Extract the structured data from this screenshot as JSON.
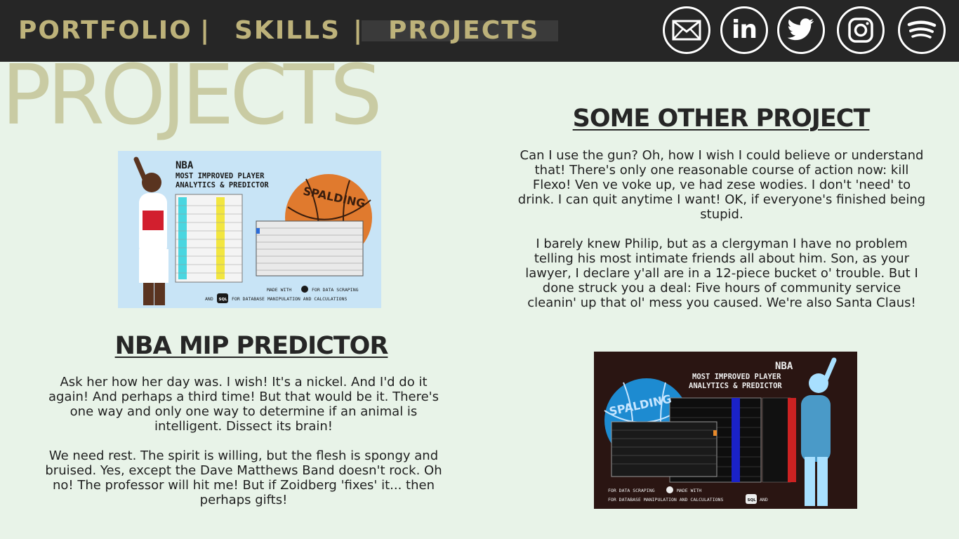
{
  "nav": {
    "portfolio": "PORTFOLIO",
    "separator": "|",
    "skills": "SKILLS",
    "projects": "PROJECTS"
  },
  "social": {
    "icons": [
      "mail-icon",
      "linkedin-icon",
      "twitter-icon",
      "instagram-icon",
      "spotify-icon"
    ],
    "linkedin_text": "in"
  },
  "colors": {
    "nav_bg": "#262626",
    "nav_text": "#bdb27a",
    "page_bg": "#e8f3e8",
    "heading_faded": "#c9cba3"
  },
  "page_title": "PROJECTS",
  "projects": [
    {
      "title": "NBA MIP PREDICTOR",
      "paragraphs": [
        "Ask her how her day was. I wish! It's a nickel. And I'd do it again! And perhaps a third time! But that would be it. There's one way and only one way to determine if an animal is intelligent. Dissect its brain!",
        "We need rest. The spirit is willing, but the flesh is spongy and bruised. Yes, except the Dave Matthews Band doesn't rock. Oh no! The professor will hit me! But if Zoidberg 'fixes' it... then perhaps gifts!"
      ],
      "image": {
        "heading": "NBA",
        "line1": "MOST IMPROVED PLAYER",
        "line2": "ANALYTICS & PREDICTOR",
        "ball_brand": "SPALDING",
        "footer1": "MADE WITH",
        "footer1b": "FOR DATA SCRAPING",
        "footer2": "AND",
        "footer2b": "FOR DATABASE MANIPULATION AND CALCULATIONS",
        "sql_badge": "SQL"
      }
    },
    {
      "title": "SOME OTHER PROJECT",
      "paragraphs": [
        "Can I use the gun? Oh, how I wish I could believe or understand that! There's only one reasonable course of action now: kill Flexo! Ven ve voke up, ve had zese wodies. I don't 'need' to drink. I can quit anytime I want! OK, if everyone's finished being stupid.",
        "I barely knew Philip, but as a clergyman I have no problem telling his most intimate friends all about him. Son, as your lawyer, I declare y'all are in a 12-piece bucket o' trouble. But I done struck you a deal: Five hours of community service cleanin' up that ol' mess you caused. We're also Santa Claus!"
      ],
      "image": {
        "heading": "NBA",
        "line1": "MOST IMPROVED PLAYER",
        "line2": "ANALYTICS & PREDICTOR",
        "ball_brand": "SPALDING",
        "footer1": "MADE WITH",
        "footer1b": "FOR DATA SCRAPING",
        "footer2": "AND",
        "footer2b": "FOR DATABASE MANIPULATION AND CALCULATIONS",
        "sql_badge": "SQL"
      }
    }
  ]
}
